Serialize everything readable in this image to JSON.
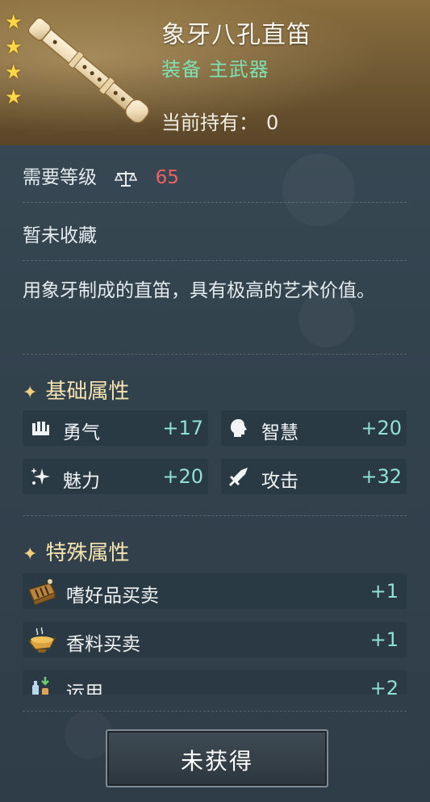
{
  "header": {
    "item_name": "象牙八孔直笛",
    "item_type": "装备 主武器",
    "held_label": "当前持有：",
    "held_count": "0",
    "star_count": 4
  },
  "requirement": {
    "label": "需要等级",
    "level": "65"
  },
  "collection_status": "暂未收藏",
  "description": "用象牙制成的直笛，具有极高的艺术价值。",
  "base_attributes": {
    "title": "基础属性",
    "items": [
      {
        "label": "勇气",
        "value": "+17",
        "icon": "courage-icon"
      },
      {
        "label": "智慧",
        "value": "+20",
        "icon": "wisdom-head-icon"
      },
      {
        "label": "魅力",
        "value": "+20",
        "icon": "sparkle-charm-icon"
      },
      {
        "label": "攻击",
        "value": "+32",
        "icon": "sword-icon"
      }
    ]
  },
  "special_attributes": {
    "title": "特殊属性",
    "items": [
      {
        "label": "嗜好品买卖",
        "value": "+1",
        "icon": "luxury-goods-crate-icon"
      },
      {
        "label": "香料买卖",
        "value": "+1",
        "icon": "spice-bowl-icon"
      },
      {
        "label": "运用",
        "value": "+2",
        "icon": "bottles-icon"
      }
    ]
  },
  "button": {
    "label": "未获得"
  },
  "colors": {
    "accent_green": "#7ee0b3",
    "level_red": "#ef6060",
    "stat_value": "#8fe0d6",
    "section_gold": "#f5e3b0"
  }
}
